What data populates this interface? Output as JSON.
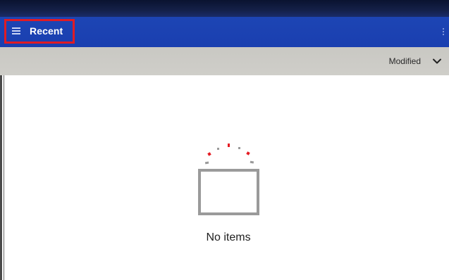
{
  "app": {
    "title": "Recent"
  },
  "sort": {
    "label": "Modified"
  },
  "empty_state": {
    "message": "No items"
  },
  "icons": {
    "menu": "hamburger-menu-icon",
    "overflow": "more-vert-icon",
    "sort": "chevron-down-icon",
    "empty": "empty-folder-icon"
  },
  "colors": {
    "app_bar": "#1a3fb0",
    "highlight": "#e01b24",
    "sort_bar": "#cbcac5",
    "empty_accent": "#e41b23",
    "empty_outline": "#9a9a9a"
  }
}
